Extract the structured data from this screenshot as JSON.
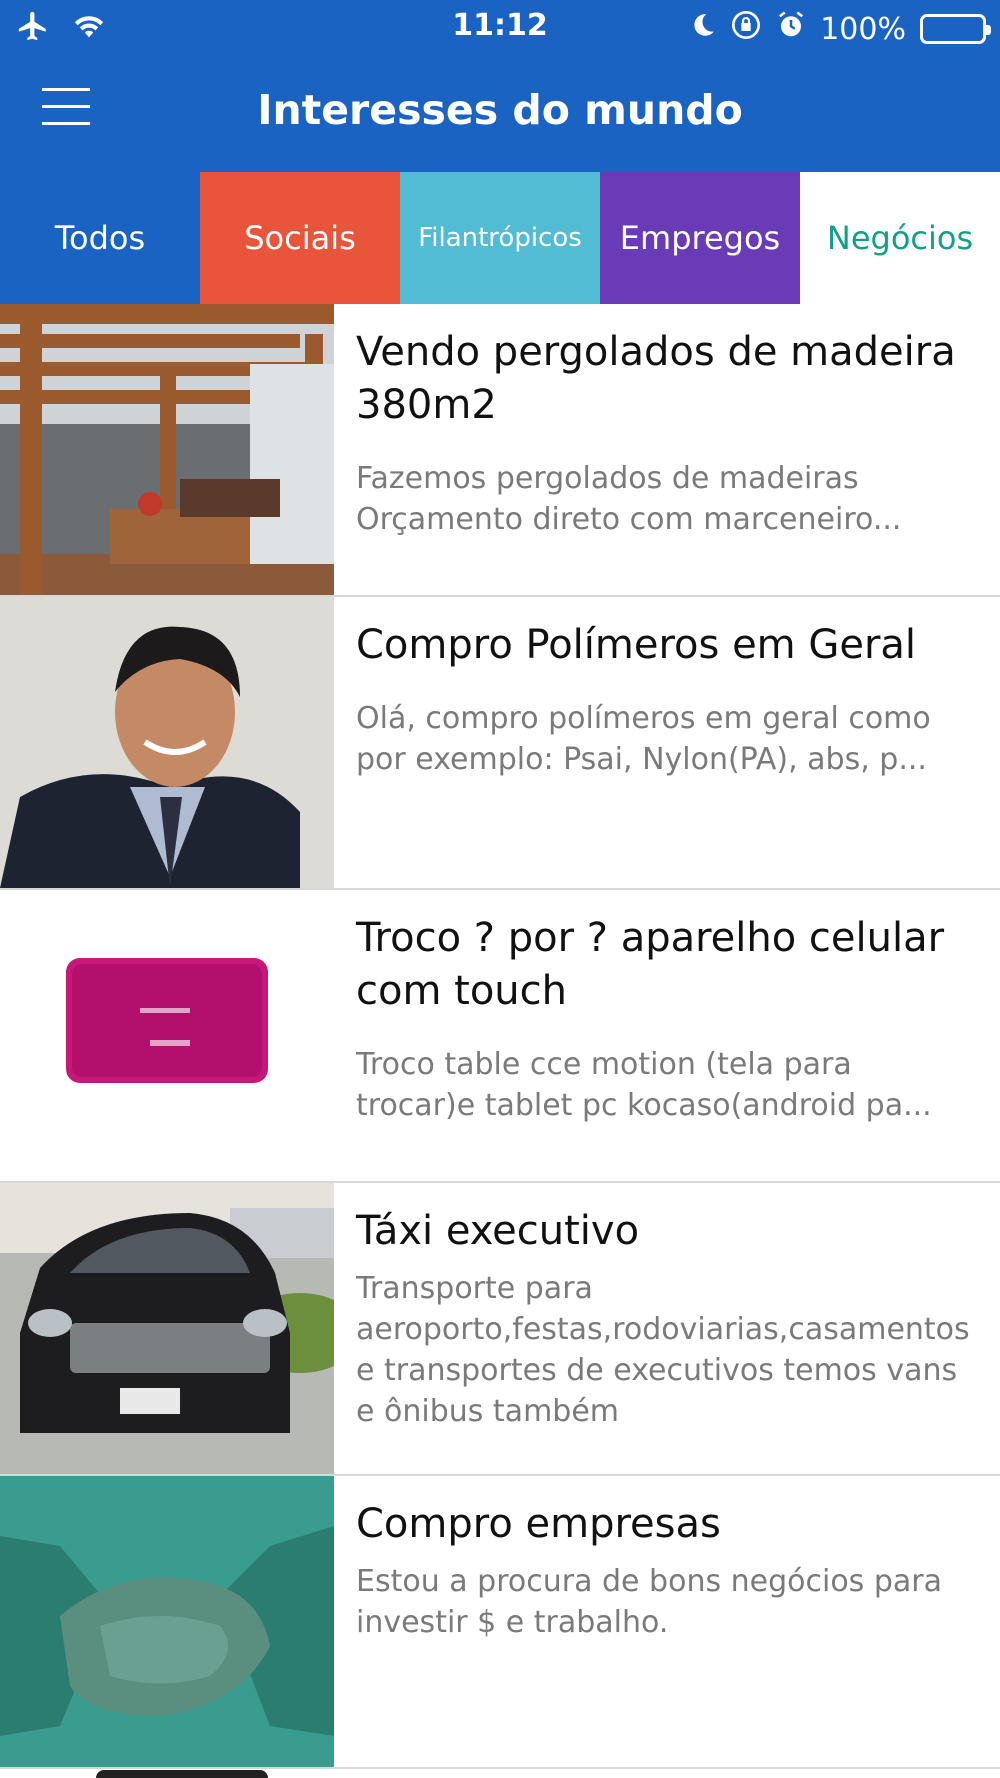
{
  "status_bar": {
    "time": "11:12",
    "battery": "100%",
    "icons": [
      "airplane-icon",
      "wifi-icon",
      "moon-icon",
      "rotation-lock-icon",
      "alarm-icon",
      "battery-icon"
    ]
  },
  "nav": {
    "title": "Interesses do mundo",
    "menu_icon": "hamburger-menu-icon"
  },
  "tabs": [
    {
      "label": "Todos",
      "bg": "#1a63c2",
      "fg": "#ffffff"
    },
    {
      "label": "Sociais",
      "bg": "#e8553a",
      "fg": "#ffffff"
    },
    {
      "label": "Filantrópicos",
      "bg": "#52bcd4",
      "fg": "#ffffff"
    },
    {
      "label": "Empregos",
      "bg": "#6a3bb7",
      "fg": "#ffffff"
    },
    {
      "label": "Negócios",
      "bg": "#ffffff",
      "fg": "#13a08a",
      "selected": true
    }
  ],
  "items": [
    {
      "title": "Vendo pergolados de madeira 380m2",
      "desc": "Fazemos pergolados de madeiras Orçamento direto com marceneiro...",
      "image": "wooden-pergola-photo"
    },
    {
      "title": "Compro Polímeros em Geral",
      "desc": "Olá, compro polímeros em geral como por exemplo: Psai, Nylon(PA), abs, p...",
      "image": "man-in-suit-photo"
    },
    {
      "title": "Troco ? por ? aparelho celular com touch",
      "desc": "Troco table cce motion (tela para trocar)e tablet pc kocaso(android pa...",
      "image": "pink-tablet-photo"
    },
    {
      "title": "Táxi executivo",
      "desc": "Transporte para aeroporto,festas,rodoviarias,casamentos e transportes de executivos temos vans e ônibus também",
      "image": "black-car-photo"
    },
    {
      "title": "Compro empresas",
      "desc": "Estou a procura de bons negócios para investir $ e trabalho.",
      "image": "handshake-photo"
    }
  ]
}
